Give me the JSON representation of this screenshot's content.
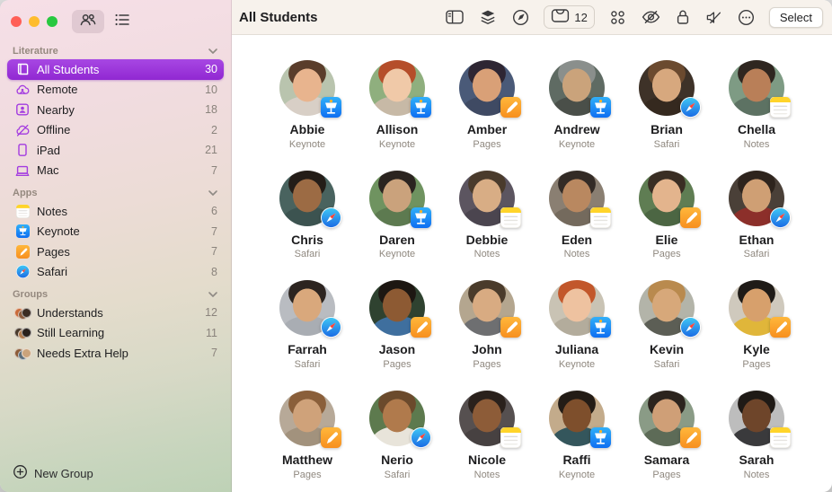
{
  "window": {
    "traffic_lights": [
      {
        "name": "close",
        "color": "#ff5f57"
      },
      {
        "name": "minimize",
        "color": "#febc2e"
      },
      {
        "name": "zoom",
        "color": "#28c840"
      }
    ]
  },
  "sidebar": {
    "view_toggle": [
      {
        "icon": "grid-view-icon",
        "selected": true
      },
      {
        "icon": "list-view-icon",
        "selected": false
      }
    ],
    "sections": [
      {
        "label": "Literature",
        "items": [
          {
            "label": "All Students",
            "count": "30",
            "icon": "book-icon",
            "selected": true
          },
          {
            "label": "Remote",
            "count": "10",
            "icon": "remote-cloud-icon",
            "selected": false
          },
          {
            "label": "Nearby",
            "count": "18",
            "icon": "nearby-contact-icon",
            "selected": false
          },
          {
            "label": "Offline",
            "count": "2",
            "icon": "offline-cloud-icon",
            "selected": false
          },
          {
            "label": "iPad",
            "count": "21",
            "icon": "ipad-icon",
            "selected": false
          },
          {
            "label": "Mac",
            "count": "7",
            "icon": "mac-icon",
            "selected": false
          }
        ]
      },
      {
        "label": "Apps",
        "items": [
          {
            "label": "Notes",
            "count": "6",
            "icon": "notes-app-icon",
            "selected": false
          },
          {
            "label": "Keynote",
            "count": "7",
            "icon": "keynote-app-icon",
            "selected": false
          },
          {
            "label": "Pages",
            "count": "7",
            "icon": "pages-app-icon",
            "selected": false
          },
          {
            "label": "Safari",
            "count": "8",
            "icon": "safari-app-icon",
            "selected": false
          }
        ]
      },
      {
        "label": "Groups",
        "items": [
          {
            "label": "Understands",
            "count": "12",
            "icon": "people-cluster-icon",
            "selected": false
          },
          {
            "label": "Still Learning",
            "count": "11",
            "icon": "people-cluster-icon",
            "selected": false
          },
          {
            "label": "Needs Extra Help",
            "count": "7",
            "icon": "people-cluster-icon",
            "selected": false
          }
        ]
      }
    ],
    "new_group_label": "New Group"
  },
  "toolbar": {
    "title": "All Students",
    "handin_count": "12",
    "select_label": "Select",
    "icons": [
      "sidebar-toggle-icon",
      "layers-icon",
      "compass-icon",
      "handin-tray-button",
      "apps-grid-icon",
      "hide-screens-icon",
      "lock-icon",
      "mute-icon",
      "more-icon"
    ]
  },
  "students": [
    {
      "name": "Abbie",
      "app": "Keynote",
      "avatar": {
        "bg": "#b9c4ae",
        "hair": "#5a3d2b",
        "skin": "#e8b48e",
        "shirt": "#d8cfc6"
      }
    },
    {
      "name": "Allison",
      "app": "Keynote",
      "avatar": {
        "bg": "#8faf7e",
        "hair": "#b54e2a",
        "skin": "#f0c9a8",
        "shirt": "#c7b9a6"
      }
    },
    {
      "name": "Amber",
      "app": "Pages",
      "avatar": {
        "bg": "#4a5a78",
        "hair": "#2e2633",
        "skin": "#d9a077",
        "shirt": "#3f4a63"
      }
    },
    {
      "name": "Andrew",
      "app": "Keynote",
      "avatar": {
        "bg": "#5f6b63",
        "hair": "#8a8f8c",
        "skin": "#caa37b",
        "shirt": "#4a4f49"
      }
    },
    {
      "name": "Brian",
      "app": "Safari",
      "avatar": {
        "bg": "#3e3228",
        "hair": "#6b4a2f",
        "skin": "#d7a87e",
        "shirt": "#35291f"
      }
    },
    {
      "name": "Chella",
      "app": "Notes",
      "avatar": {
        "bg": "#7e9b84",
        "hair": "#2f2620",
        "skin": "#b97f58",
        "shirt": "#5d7263"
      }
    },
    {
      "name": "Chris",
      "app": "Safari",
      "avatar": {
        "bg": "#49635f",
        "hair": "#241d18",
        "skin": "#9c6b44",
        "shirt": "#3c5350"
      }
    },
    {
      "name": "Daren",
      "app": "Keynote",
      "avatar": {
        "bg": "#6f9360",
        "hair": "#2b2420",
        "skin": "#caa27c",
        "shirt": "#5d7a50"
      }
    },
    {
      "name": "Debbie",
      "app": "Notes",
      "avatar": {
        "bg": "#5c5560",
        "hair": "#4a3b2c",
        "skin": "#d8ad85",
        "shirt": "#4b454f"
      }
    },
    {
      "name": "Eden",
      "app": "Notes",
      "avatar": {
        "bg": "#8a7f72",
        "hair": "#332b26",
        "skin": "#b98860",
        "shirt": "#746a5d"
      }
    },
    {
      "name": "Elie",
      "app": "Pages",
      "avatar": {
        "bg": "#5f7d53",
        "hair": "#3a2e24",
        "skin": "#e3b48d",
        "shirt": "#4c6643"
      }
    },
    {
      "name": "Ethan",
      "app": "Safari",
      "avatar": {
        "bg": "#4a4038",
        "hair": "#2e241d",
        "skin": "#cf9f74",
        "shirt": "#8c2f2a"
      }
    },
    {
      "name": "Farrah",
      "app": "Safari",
      "avatar": {
        "bg": "#b9bcc1",
        "hair": "#2c2420",
        "skin": "#d9a87c",
        "shirt": "#a9adb3"
      }
    },
    {
      "name": "Jason",
      "app": "Pages",
      "avatar": {
        "bg": "#2f4230",
        "hair": "#1d1712",
        "skin": "#8d5a33",
        "shirt": "#3f6f9e"
      }
    },
    {
      "name": "John",
      "app": "Pages",
      "avatar": {
        "bg": "#b4a68f",
        "hair": "#4a3b2b",
        "skin": "#d8ab82",
        "shirt": "#6e6f71"
      }
    },
    {
      "name": "Juliana",
      "app": "Keynote",
      "avatar": {
        "bg": "#c9c3b4",
        "hair": "#c2572b",
        "skin": "#eec2a0",
        "shirt": "#b3ac9c"
      }
    },
    {
      "name": "Kevin",
      "app": "Safari",
      "avatar": {
        "bg": "#b3b4a9",
        "hair": "#b98a4e",
        "skin": "#d7a87a",
        "shirt": "#5c5e55"
      }
    },
    {
      "name": "Kyle",
      "app": "Pages",
      "avatar": {
        "bg": "#cfc9bd",
        "hair": "#1f1b17",
        "skin": "#d7a06c",
        "shirt": "#e0b63a"
      }
    },
    {
      "name": "Matthew",
      "app": "Pages",
      "avatar": {
        "bg": "#b7a998",
        "hair": "#8a5f3a",
        "skin": "#cfa27a",
        "shirt": "#a2927d"
      }
    },
    {
      "name": "Nerio",
      "app": "Safari",
      "avatar": {
        "bg": "#5d7a4e",
        "hair": "#6b4a2c",
        "skin": "#b07a4c",
        "shirt": "#e8e4da"
      }
    },
    {
      "name": "Nicole",
      "app": "Notes",
      "avatar": {
        "bg": "#565050",
        "hair": "#2a211c",
        "skin": "#8d5c38",
        "shirt": "#474141"
      }
    },
    {
      "name": "Raffi",
      "app": "Keynote",
      "avatar": {
        "bg": "#c3ab8b",
        "hair": "#231c16",
        "skin": "#7e4f2c",
        "shirt": "#34565c"
      }
    },
    {
      "name": "Samara",
      "app": "Pages",
      "avatar": {
        "bg": "#8a9b86",
        "hair": "#2c241e",
        "skin": "#cf9f77",
        "shirt": "#5d6b57"
      }
    },
    {
      "name": "Sarah",
      "app": "Notes",
      "avatar": {
        "bg": "#bdbdbd",
        "hair": "#1f1a16",
        "skin": "#6e452a",
        "shirt": "#3a3a3c"
      }
    }
  ],
  "colors": {
    "accent_purple": "#9c36d6",
    "sidebar_icon_purple": "#a33be0",
    "toolbar_bg": "#f7f2ec",
    "content_bg": "#ffffff"
  }
}
